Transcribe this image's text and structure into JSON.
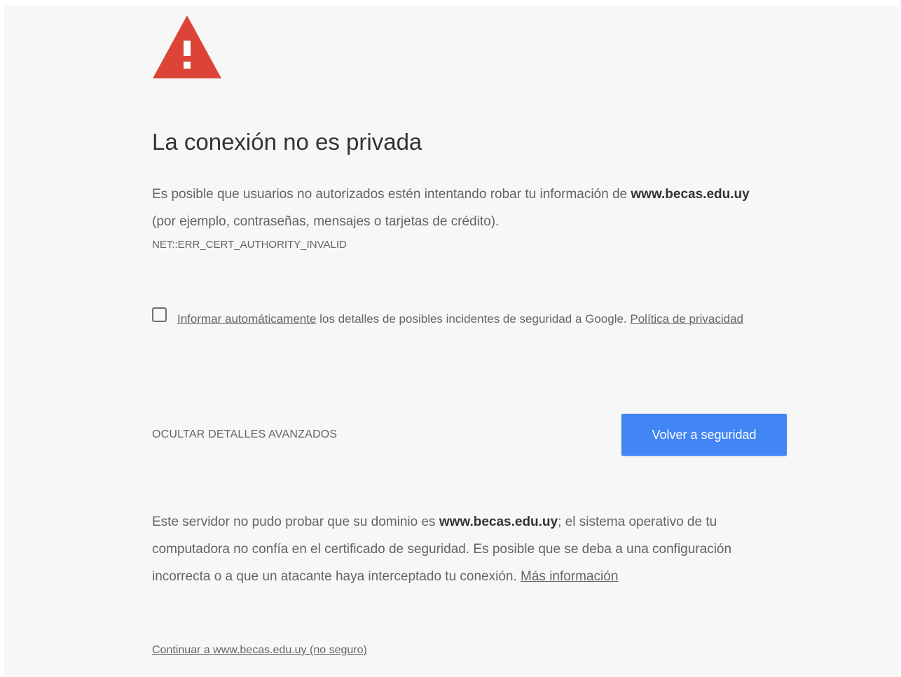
{
  "interstitial": {
    "icon": "warning-triangle-icon",
    "icon_color": "#db4437",
    "title": "La conexión no es privada",
    "description": {
      "part1": "Es posible que usuarios no autorizados estén intentando robar tu información de ",
      "domain": "www.becas.edu.uy",
      "part2": " (por ejemplo, contraseñas, mensajes o tarjetas de crédito)."
    },
    "error_code": "NET::ERR_CERT_AUTHORITY_INVALID",
    "report": {
      "checked": false,
      "link_text": "Informar automáticamente",
      "text": " los detalles de posibles incidentes de seguridad a Google. ",
      "privacy_link": "Política de privacidad"
    },
    "details_toggle_label": "OCULTAR DETALLES AVANZADOS",
    "primary_button_label": "Volver a seguridad",
    "primary_button_color": "#4285f4",
    "details": {
      "part1": "Este servidor no pudo probar que su dominio es ",
      "domain": "www.becas.edu.uy",
      "part2": "; el sistema operativo de tu computadora no confía en el certificado de seguridad. Es posible que se deba a una configuración incorrecta o a que un atacante haya interceptado tu conexión. ",
      "more_info_link": "Más información"
    },
    "proceed_link": "Continuar a www.becas.edu.uy (no seguro)"
  }
}
